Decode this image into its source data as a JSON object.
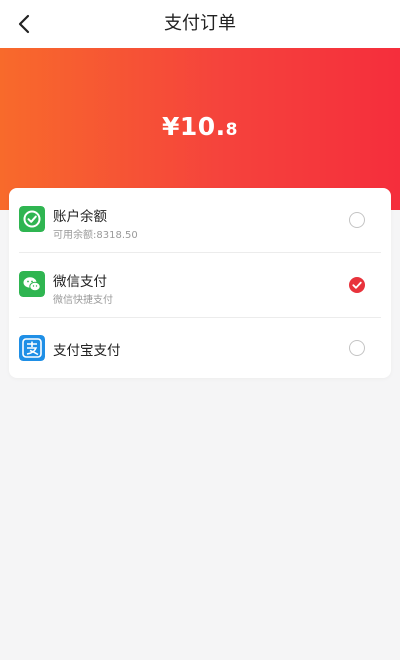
{
  "header": {
    "title": "支付订单"
  },
  "payment": {
    "amount_integer": "¥10.",
    "amount_decimal": "8"
  },
  "methods": [
    {
      "name": "账户余额",
      "sub": "可用余额:8318.50",
      "icon": "wallet-icon",
      "selected": false,
      "color": "#2fb551"
    },
    {
      "name": "微信支付",
      "sub": "微信快捷支付",
      "icon": "wechat-icon",
      "selected": true,
      "color": "#2fb551"
    },
    {
      "name": "支付宝支付",
      "sub": "",
      "icon": "alipay-icon",
      "selected": false,
      "color": "#1f8fe6"
    }
  ],
  "colors": {
    "hero_start": "#f86a2b",
    "hero_end": "#f52e3c",
    "check": "#e8333c"
  }
}
